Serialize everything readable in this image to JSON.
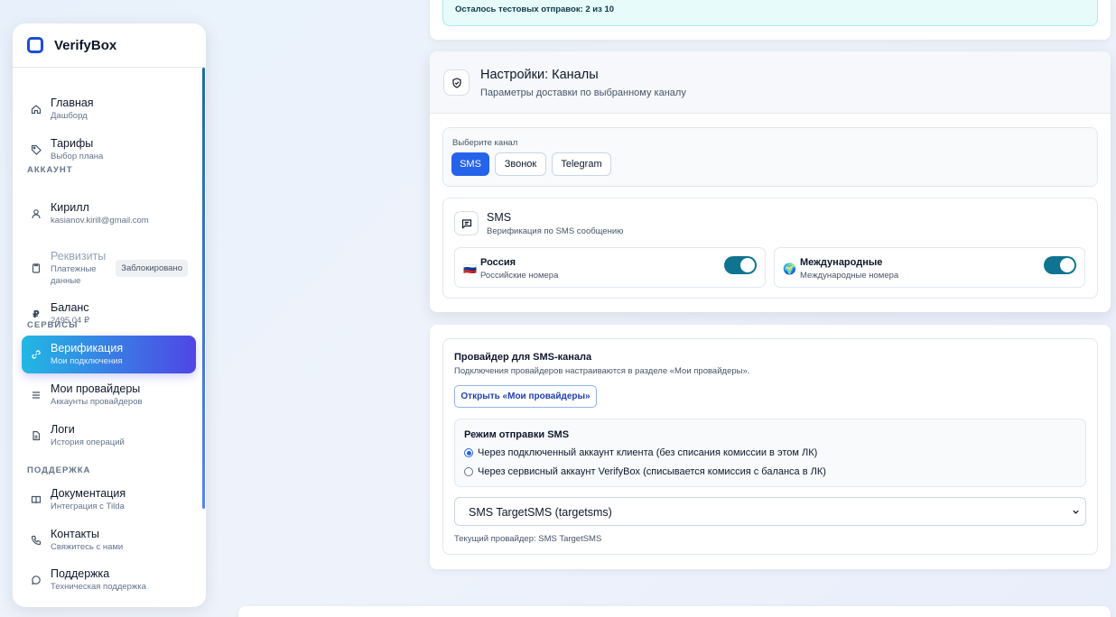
{
  "brand": {
    "name": "VerifyBox"
  },
  "sidebar": {
    "items": [
      {
        "title": "Главная",
        "sub": "Дашборд"
      },
      {
        "title": "Тарифы",
        "sub": "Выбор плана"
      },
      {
        "title": "Кирилл",
        "sub": "kasianov.kirill@gmail.com"
      },
      {
        "title": "Реквизиты",
        "sub": "Платежные данные",
        "badge": "Заблокировано"
      },
      {
        "title": "Баланс",
        "sub": "2495.04 ₽"
      },
      {
        "title": "Верификация",
        "sub": "Мои подключения"
      },
      {
        "title": "Мои провайдеры",
        "sub": "Аккаунты провайдеров"
      },
      {
        "title": "Логи",
        "sub": "История операций"
      },
      {
        "title": "Документация",
        "sub": "Интеграция с Tilda"
      },
      {
        "title": "Контакты",
        "sub": "Свяжитесь с нами"
      },
      {
        "title": "Поддержка",
        "sub": "Техническая поддержка"
      }
    ],
    "sections": {
      "account": "АККАУНТ",
      "services": "СЕРВИСЫ",
      "support": "ПОДДЕРЖКА"
    },
    "balance_icon": "₽"
  },
  "notice": {
    "text": "Осталось тестовых отправок: 2 из 10"
  },
  "channels": {
    "title": "Настройки: Каналы",
    "subtitle": "Параметры доставки по выбранному каналу",
    "select_label": "Выберите канал",
    "options": [
      "SMS",
      "Звонок",
      "Telegram"
    ],
    "selected": "SMS",
    "sms": {
      "title": "SMS",
      "subtitle": "Верификация по SMS сообщению",
      "regions": [
        {
          "title": "Россия",
          "sub": "Российские номера",
          "flag": "🇷🇺",
          "enabled": true
        },
        {
          "title": "Международные",
          "sub": "Международные номера",
          "flag": "🌍",
          "enabled": true
        }
      ]
    }
  },
  "provider": {
    "title": "Провайдер для SMS-канала",
    "subtitle": "Подключения провайдеров настраиваются в разделе «Мои провайдеры».",
    "open_button": "Открыть «Мои провайдеры»",
    "mode_title": "Режим отправки SMS",
    "mode_options": [
      "Через подключенный аккаунт клиента (без списания комиссии в этом ЛК)",
      "Через сервисный аккаунт VerifyBox (списывается комиссия с баланса в ЛК)"
    ],
    "mode_selected_index": 0,
    "select_value": "SMS TargetSMS (targetsms)",
    "current": "Текущий провайдер: SMS TargetSMS"
  },
  "colors": {
    "accent": "#2563eb",
    "toggle": "#0e7490",
    "active_from": "#22b8e4",
    "active_to": "#4f46e5"
  }
}
